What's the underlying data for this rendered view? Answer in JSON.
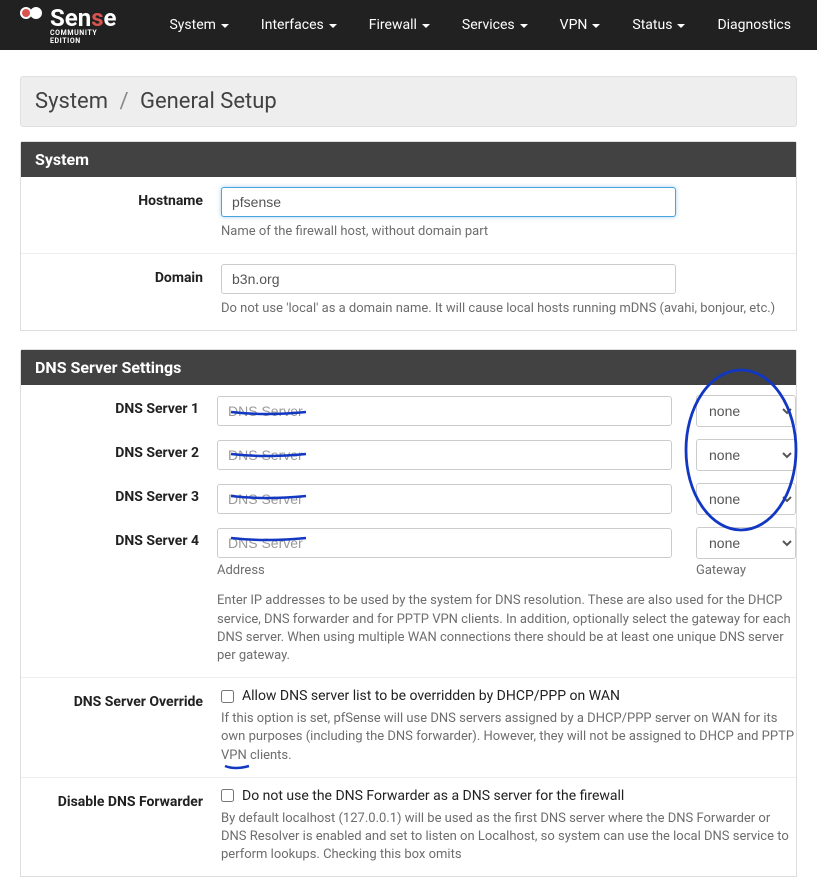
{
  "brand": {
    "name_plain": "Sen",
    "name_accent": "s",
    "name_end": "e",
    "subtitle": "COMMUNITY EDITION"
  },
  "nav": [
    {
      "label": "System"
    },
    {
      "label": "Interfaces"
    },
    {
      "label": "Firewall"
    },
    {
      "label": "Services"
    },
    {
      "label": "VPN"
    },
    {
      "label": "Status"
    },
    {
      "label": "Diagnostics"
    }
  ],
  "breadcrumb": {
    "root": "System",
    "page": "General Setup"
  },
  "system_panel": {
    "title": "System",
    "hostname": {
      "label": "Hostname",
      "value": "pfsense",
      "help": "Name of the firewall host, without domain part"
    },
    "domain": {
      "label": "Domain",
      "value": "b3n.org",
      "help": "Do not use 'local' as a domain name. It will cause local hosts running mDNS (avahi, bonjour, etc.)"
    }
  },
  "dns_panel": {
    "title": "DNS Server Settings",
    "servers": [
      {
        "label": "DNS Server 1",
        "placeholder": "DNS Server",
        "value": "",
        "gateway": "none"
      },
      {
        "label": "DNS Server 2",
        "placeholder": "DNS Server",
        "value": "",
        "gateway": "none"
      },
      {
        "label": "DNS Server 3",
        "placeholder": "DNS Server",
        "value": "",
        "gateway": "none"
      },
      {
        "label": "DNS Server 4",
        "placeholder": "DNS Server",
        "value": "",
        "gateway": "none"
      }
    ],
    "col_address": "Address",
    "col_gateway": "Gateway",
    "help": "Enter IP addresses to be used by the system for DNS resolution. These are also used for the DHCP service, DNS forwarder and for PPTP VPN clients. In addition, optionally select the gateway for each DNS server. When using multiple WAN connections there should be at least one unique DNS server per gateway.",
    "override": {
      "label": "DNS Server Override",
      "checkbox_label": "Allow DNS server list to be overridden by DHCP/PPP on WAN",
      "help": "If this option is set, pfSense will use DNS servers assigned by a DHCP/PPP server on WAN for its own purposes (including the DNS forwarder). However, they will not be assigned to DHCP and PPTP VPN clients."
    },
    "disable_forwarder": {
      "label": "Disable DNS Forwarder",
      "checkbox_label": "Do not use the DNS Forwarder as a DNS server for the firewall",
      "help": "By default localhost (127.0.0.1) will be used as the first DNS server where the DNS Forwarder or DNS Resolver is enabled and set to listen on Localhost, so system can use the local DNS service to perform lookups. Checking this box omits"
    }
  }
}
